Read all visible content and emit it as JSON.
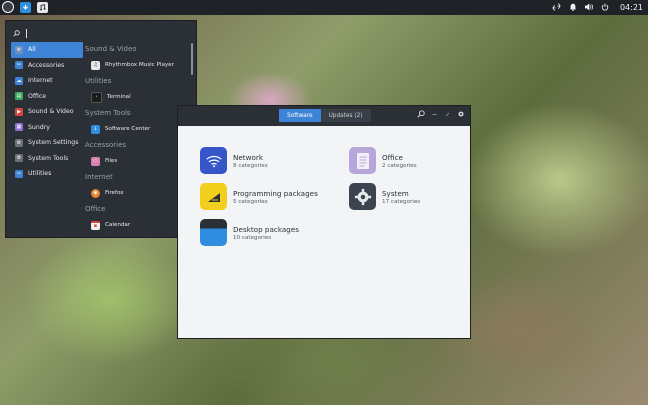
{
  "panel": {
    "clock": "04:21",
    "apps": [
      {
        "icon": "software-center-icon"
      },
      {
        "icon": "music-player-icon"
      }
    ],
    "tray": [
      "network-icon",
      "notifications-icon",
      "volume-icon",
      "power-icon"
    ]
  },
  "menu": {
    "search_value": "",
    "categories": [
      {
        "label": "All",
        "icon": "gear-icon",
        "color": "#3d84d6",
        "active": true
      },
      {
        "label": "Accessories",
        "icon": "accessories-icon",
        "color": "#3d84d6"
      },
      {
        "label": "Internet",
        "icon": "cloud-icon",
        "color": "#3d84d6"
      },
      {
        "label": "Office",
        "icon": "office-icon",
        "color": "#3aa85a"
      },
      {
        "label": "Sound & Video",
        "icon": "media-icon",
        "color": "#d6453d"
      },
      {
        "label": "Sundry",
        "icon": "grid-icon",
        "color": "#8a6fd1"
      },
      {
        "label": "System Settings",
        "icon": "settings-icon",
        "color": "#6a717c"
      },
      {
        "label": "System Tools",
        "icon": "tools-icon",
        "color": "#6a717c"
      },
      {
        "label": "Utilities",
        "icon": "utilities-icon",
        "color": "#3d84d6"
      }
    ],
    "sections": [
      {
        "title": "Sound & Video",
        "app": "Rhythmbox Music Player",
        "icon": "rhythmbox-icon",
        "color": "#e9e9e9"
      },
      {
        "title": "Utilities",
        "app": "Terminal",
        "icon": "terminal-icon",
        "color": "#1b1b1b"
      },
      {
        "title": "System Tools",
        "app": "Software Center",
        "icon": "software-center-icon",
        "color": "#2f8ee0"
      },
      {
        "title": "Accessories",
        "app": "Files",
        "icon": "files-icon",
        "color": "#d97fb0"
      },
      {
        "title": "Internet",
        "app": "Firefox",
        "icon": "firefox-icon",
        "color": "#e8842c"
      },
      {
        "title": "Office",
        "app": "Calendar",
        "icon": "calendar-icon",
        "color": "#f0f0f0"
      }
    ]
  },
  "software": {
    "tabs": [
      {
        "label": "Software",
        "active": true
      },
      {
        "label": "Updates (2)",
        "active": false
      }
    ],
    "categories": [
      {
        "title": "Network",
        "sub": "8 categories",
        "icon": "network-wifi-icon",
        "color": "#3555c9"
      },
      {
        "title": "Office",
        "sub": "2 categories",
        "icon": "document-icon",
        "color": "#b7a6d9"
      },
      {
        "title": "Programming packages",
        "sub": "5 categories",
        "icon": "programming-icon",
        "color": "#f2cf1d"
      },
      {
        "title": "System",
        "sub": "17 categories",
        "icon": "system-gear-icon",
        "color": "#3b4450"
      },
      {
        "title": "Desktop packages",
        "sub": "10 categories",
        "icon": "desktop-icon",
        "color": "#2f8ee0"
      }
    ]
  }
}
